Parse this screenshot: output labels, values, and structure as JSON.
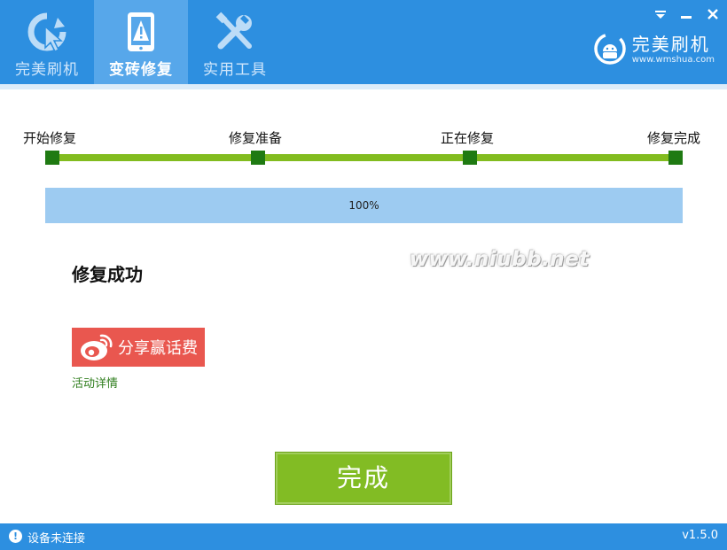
{
  "header": {
    "tabs": [
      {
        "label": "完美刷机",
        "icon": "refresh-cursor-icon",
        "active": false
      },
      {
        "label": "变砖修复",
        "icon": "tablet-warning-icon",
        "active": true
      },
      {
        "label": "实用工具",
        "icon": "tools-icon",
        "active": false
      }
    ],
    "brand": {
      "name": "完美刷机",
      "url": "www.wmshua.com",
      "icon": "android-logo-icon"
    },
    "window_controls": [
      "dropdown-icon",
      "minimize-icon",
      "close-icon"
    ]
  },
  "steps": {
    "items": [
      "开始修复",
      "修复准备",
      "正在修复",
      "修复完成"
    ],
    "completed": 4
  },
  "progress": {
    "value": 1.0,
    "text": "100%"
  },
  "watermark": "www.niubb.net",
  "result": {
    "title": "修复成功"
  },
  "share": {
    "label": "分享赢话费",
    "icon": "weibo-icon",
    "link_text": "活动详情"
  },
  "done_button": {
    "label": "完成"
  },
  "status": {
    "text": "设备未连接",
    "icon": "alert-icon",
    "version": "v1.5.0"
  },
  "colors": {
    "header": "#2d8fe0",
    "active_tab": "#57a7ea",
    "progress_green": "#82bc1f",
    "node": "#1f7a12",
    "share_red": "#e9574f"
  }
}
